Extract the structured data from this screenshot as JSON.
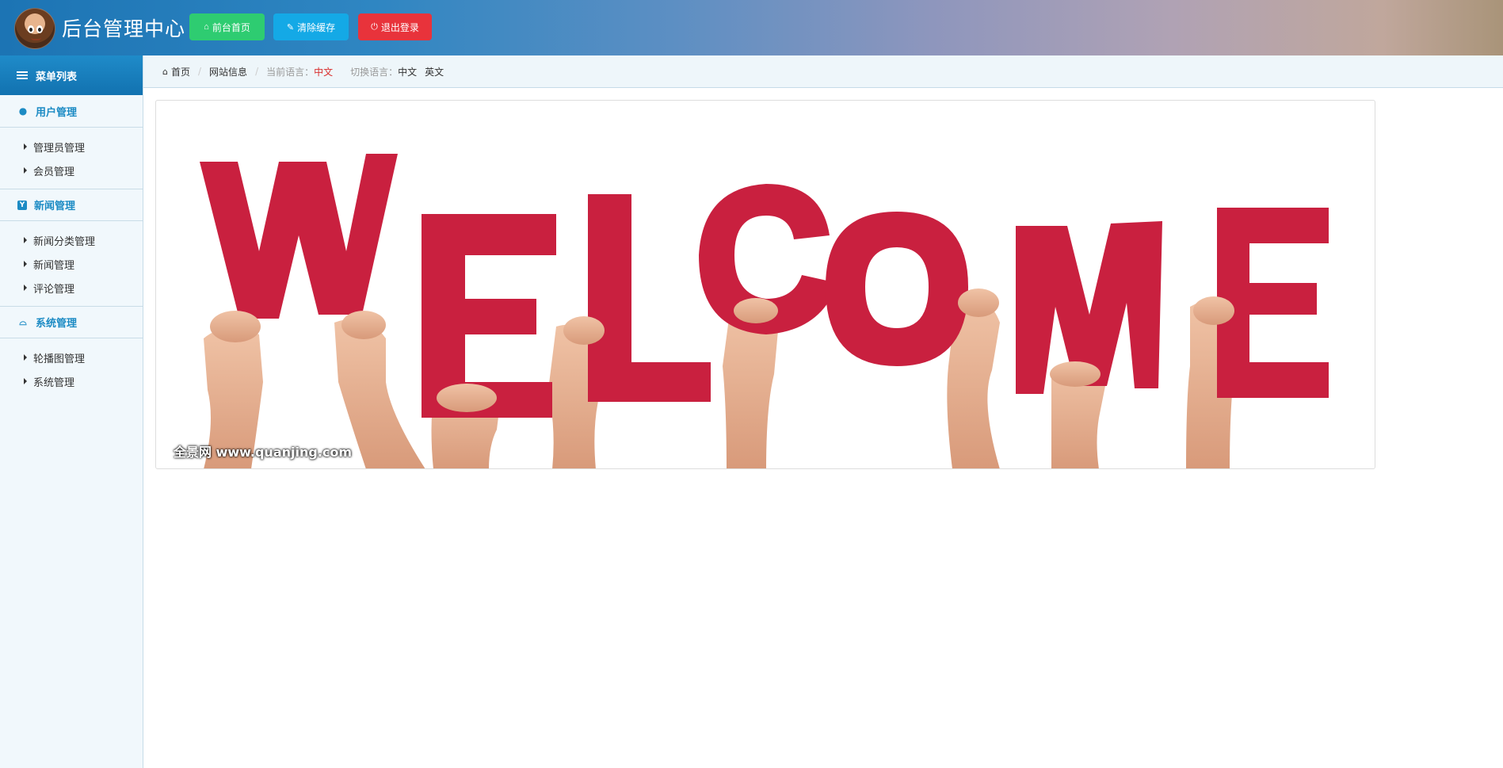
{
  "header": {
    "title": "后台管理中心",
    "buttons": {
      "home": "前台首页",
      "clear_cache": "清除缓存",
      "logout": "退出登录"
    },
    "colors": {
      "home": "#2ecc71",
      "clear_cache": "#14a9e6",
      "logout": "#e8333b"
    }
  },
  "sidebar": {
    "menu_title": "菜单列表",
    "groups": [
      {
        "title": "用户管理",
        "icon": "user-icon",
        "items": [
          "管理员管理",
          "会员管理"
        ]
      },
      {
        "title": "新闻管理",
        "icon": "y-badge-icon",
        "items": [
          "新闻分类管理",
          "新闻管理",
          "评论管理"
        ]
      },
      {
        "title": "系统管理",
        "icon": "inbox-icon",
        "items": [
          "轮播图管理",
          "系统管理"
        ]
      }
    ]
  },
  "breadcrumb": {
    "home": "首页",
    "current": "网站信息",
    "lang_label": "当前语言：",
    "lang_value": "中文",
    "switch_label": "切换语言：",
    "switch_options": [
      "中文",
      "英文"
    ]
  },
  "banner": {
    "watermark": "全景网  www.quanjing.com"
  }
}
